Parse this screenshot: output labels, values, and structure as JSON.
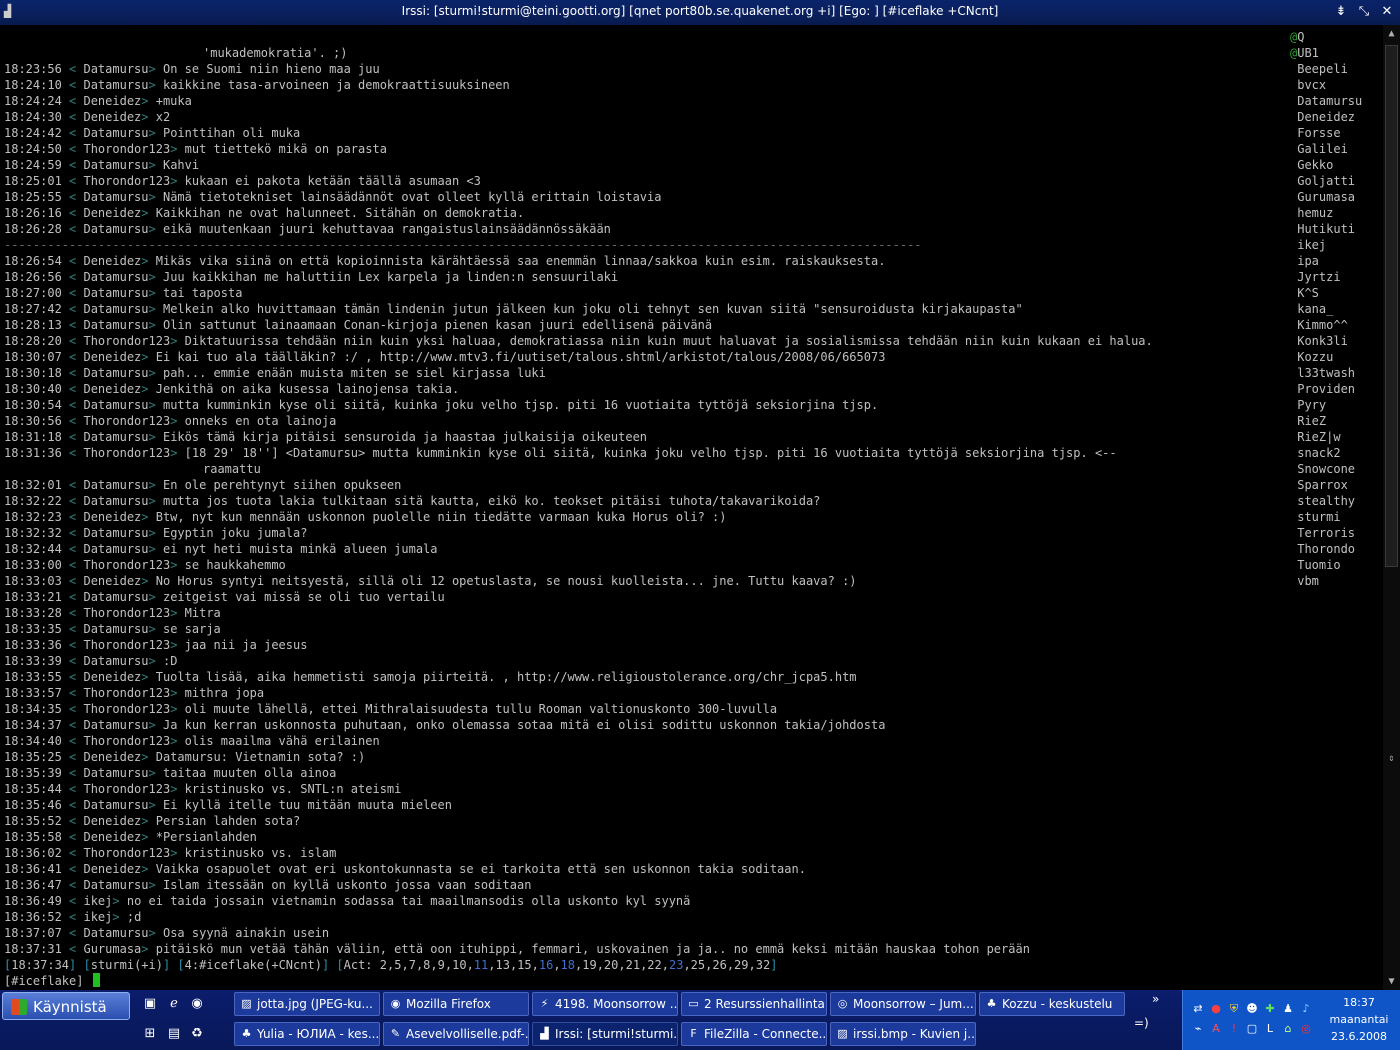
{
  "window": {
    "title": "Irssi: [sturmi!sturmi@teini.gootti.org] [qnet port80b.se.quakenet.org +i]  [Ego: ]  [#iceflake +CNcnt]",
    "app_icon": "terminal-icon",
    "buttons": [
      "minimize",
      "maximize",
      "close"
    ]
  },
  "chat": {
    "lines": [
      {
        "ts": "",
        "nick": "",
        "msg": "'mukademokratia'. ;)",
        "type": "cont"
      },
      {
        "ts": "18:23:56",
        "nick": "Datamursu",
        "msg": "On se Suomi niin hieno maa juu"
      },
      {
        "ts": "18:24:10",
        "nick": "Datamursu",
        "msg": "kaikkine tasa-arvoineen ja demokraattisuuksineen"
      },
      {
        "ts": "18:24:24",
        "nick": "Deneidez",
        "msg": "+muka"
      },
      {
        "ts": "18:24:30",
        "nick": "Deneidez",
        "msg": "x2"
      },
      {
        "ts": "18:24:42",
        "nick": "Datamursu",
        "msg": "Pointtihan oli muka"
      },
      {
        "ts": "18:24:50",
        "nick": "Thorondor123",
        "msg": "mut tiettekö mikä on parasta"
      },
      {
        "ts": "18:24:59",
        "nick": "Datamursu",
        "msg": "Kahvi"
      },
      {
        "ts": "18:25:01",
        "nick": "Thorondor123",
        "msg": "kukaan ei pakota ketään täällä asumaan <3"
      },
      {
        "ts": "18:25:55",
        "nick": "Datamursu",
        "msg": "Nämä tietotekniset lainsäädännöt ovat olleet kyllä erittain loistavia"
      },
      {
        "ts": "18:26:16",
        "nick": "Deneidez",
        "msg": "Kaikkihan ne ovat halunneet. Sitähän on demokratia."
      },
      {
        "ts": "18:26:28",
        "nick": "Datamursu",
        "msg": "eikä muutenkaan juuri kehuttavaa rangaistuslainsäädännössäkään"
      },
      {
        "ts": "",
        "nick": "",
        "msg": "-------------------------------------------------------------------------------------------------------------------------------",
        "type": "marker"
      },
      {
        "ts": "18:26:54",
        "nick": "Deneidez",
        "msg": "Mikäs vika siinä on että kopioinnista kärähtäessä saa enemmän linnaa/sakkoa kuin esim. raiskauksesta."
      },
      {
        "ts": "18:26:56",
        "nick": "Datamursu",
        "msg": "Juu kaikkihan me haluttiin Lex karpela ja linden:n sensuurilaki"
      },
      {
        "ts": "18:27:00",
        "nick": "Datamursu",
        "msg": "tai taposta"
      },
      {
        "ts": "18:27:42",
        "nick": "Datamursu",
        "msg": "Melkein alko huvittamaan tämän lindenin jutun jälkeen kun joku oli tehnyt sen kuvan siitä \"sensuroidusta kirjakaupasta\""
      },
      {
        "ts": "18:28:13",
        "nick": "Datamursu",
        "msg": "Olin sattunut lainaamaan Conan-kirjoja pienen kasan juuri edellisenä päivänä"
      },
      {
        "ts": "18:28:20",
        "nick": "Thorondor123",
        "msg": "Diktatuurissa tehdään niin kuin yksi haluaa, demokratiassa niin kuin muut haluavat ja sosialismissa tehdään niin kuin kukaan ei halua."
      },
      {
        "ts": "18:30:07",
        "nick": "Deneidez",
        "msg": "Ei kai tuo ala täälläkin? :/ , http://www.mtv3.fi/uutiset/talous.shtml/arkistot/talous/2008/06/665073"
      },
      {
        "ts": "18:30:18",
        "nick": "Datamursu",
        "msg": "pah... emmie enään muista miten se siel kirjassa luki"
      },
      {
        "ts": "18:30:40",
        "nick": "Deneidez",
        "msg": "Jenkithä on aika kusessa lainojensa takia."
      },
      {
        "ts": "18:30:54",
        "nick": "Datamursu",
        "msg": "mutta kumminkin kyse oli siitä, kuinka joku velho tjsp. piti 16 vuotiaita tyttöjä seksiorjina tjsp."
      },
      {
        "ts": "18:30:56",
        "nick": "Thorondor123",
        "msg": "onneks en ota lainoja"
      },
      {
        "ts": "18:31:18",
        "nick": "Datamursu",
        "msg": "Eikös tämä kirja pitäisi sensuroida ja haastaa julkaisija oikeuteen"
      },
      {
        "ts": "18:31:36",
        "nick": "Thorondor123",
        "msg": "[18 29' 18''] <Datamursu> mutta kumminkin kyse oli siitä, kuinka joku velho tjsp. piti 16 vuotiaita tyttöjä seksiorjina tjsp. <--"
      },
      {
        "ts": "",
        "nick": "",
        "msg": "raamattu",
        "type": "cont"
      },
      {
        "ts": "18:32:01",
        "nick": "Datamursu",
        "msg": "En ole perehtynyt siihen opukseen"
      },
      {
        "ts": "18:32:22",
        "nick": "Datamursu",
        "msg": "mutta jos tuota lakia tulkitaan sitä kautta, eikö ko. teokset pitäisi tuhota/takavarikoida?"
      },
      {
        "ts": "18:32:23",
        "nick": "Deneidez",
        "msg": "Btw, nyt kun mennään uskonnon puolelle niin tiedätte varmaan kuka Horus oli? :)"
      },
      {
        "ts": "18:32:32",
        "nick": "Datamursu",
        "msg": "Egyptin joku jumala?"
      },
      {
        "ts": "18:32:44",
        "nick": "Datamursu",
        "msg": "ei nyt heti muista minkä alueen jumala"
      },
      {
        "ts": "18:33:00",
        "nick": "Thorondor123",
        "msg": "se haukkahemmo"
      },
      {
        "ts": "18:33:03",
        "nick": "Deneidez",
        "msg": "No Horus syntyi neitsyestä, sillä oli 12 opetuslasta, se nousi kuolleista... jne. Tuttu kaava? :)"
      },
      {
        "ts": "18:33:21",
        "nick": "Datamursu",
        "msg": "zeitgeist vai missä se oli tuo vertailu"
      },
      {
        "ts": "18:33:28",
        "nick": "Thorondor123",
        "msg": "Mitra"
      },
      {
        "ts": "18:33:35",
        "nick": "Datamursu",
        "msg": "se sarja"
      },
      {
        "ts": "18:33:36",
        "nick": "Thorondor123",
        "msg": "jaa nii ja jeesus"
      },
      {
        "ts": "18:33:39",
        "nick": "Datamursu",
        "msg": ":D"
      },
      {
        "ts": "18:33:55",
        "nick": "Deneidez",
        "msg": "Tuolta lisää, aika hemmetisti samoja piirteitä. , http://www.religioustolerance.org/chr_jcpa5.htm"
      },
      {
        "ts": "18:33:57",
        "nick": "Thorondor123",
        "msg": "mithra jopa"
      },
      {
        "ts": "18:34:35",
        "nick": "Thorondor123",
        "msg": "oli muute lähellä, ettei Mithralaisuudesta tullu Rooman valtionuskonto 300-luvulla"
      },
      {
        "ts": "18:34:37",
        "nick": "Datamursu",
        "msg": "Ja kun kerran uskonnosta puhutaan, onko olemassa sotaa mitä ei olisi sodittu uskonnon takia/johdosta"
      },
      {
        "ts": "18:34:40",
        "nick": "Thorondor123",
        "msg": "olis maailma vähä erilainen"
      },
      {
        "ts": "18:35:25",
        "nick": "Deneidez",
        "msg": "Datamursu: Vietnamin sota? :)"
      },
      {
        "ts": "18:35:39",
        "nick": "Datamursu",
        "msg": "taitaa muuten olla ainoa"
      },
      {
        "ts": "18:35:44",
        "nick": "Thorondor123",
        "msg": "kristinusko vs. SNTL:n ateismi"
      },
      {
        "ts": "18:35:46",
        "nick": "Datamursu",
        "msg": "Ei kyllä itelle tuu mitään muuta mieleen"
      },
      {
        "ts": "18:35:52",
        "nick": "Deneidez",
        "msg": "Persian lahden sota?"
      },
      {
        "ts": "18:35:58",
        "nick": "Deneidez",
        "msg": "*Persianlahden"
      },
      {
        "ts": "18:36:02",
        "nick": "Thorondor123",
        "msg": "kristinusko vs. islam"
      },
      {
        "ts": "18:36:41",
        "nick": "Deneidez",
        "msg": "Vaikka osapuolet ovat eri uskontokunnasta se ei tarkoita että sen uskonnon takia soditaan."
      },
      {
        "ts": "18:36:47",
        "nick": "Datamursu",
        "msg": "Islam itessään on kyllä uskonto jossa vaan soditaan"
      },
      {
        "ts": "18:36:49",
        "nick": "ikej",
        "msg": "no ei taida jossain vietnamin sodassa tai maailmansodis olla uskonto kyl syynä"
      },
      {
        "ts": "18:36:52",
        "nick": "ikej",
        "msg": ";d"
      },
      {
        "ts": "18:37:07",
        "nick": "Datamursu",
        "msg": "Osa syynä ainakin usein"
      },
      {
        "ts": "18:37:31",
        "nick": "Gurumasa",
        "msg": "pitäiskö mun vetää tähän väliin, että oon ituhippi, femmari, uskovainen ja ja.. no emmä keksi mitään hauskaa tohon perään"
      }
    ]
  },
  "nicklist": [
    {
      "mode": "@",
      "name": "Q"
    },
    {
      "mode": "@",
      "name": "UB1"
    },
    {
      "mode": " ",
      "name": "Beepeli"
    },
    {
      "mode": " ",
      "name": "bvcx"
    },
    {
      "mode": " ",
      "name": "Datamursu"
    },
    {
      "mode": " ",
      "name": "Deneidez"
    },
    {
      "mode": " ",
      "name": "Forsse"
    },
    {
      "mode": " ",
      "name": "Galilei"
    },
    {
      "mode": " ",
      "name": "Gekko"
    },
    {
      "mode": " ",
      "name": "Goljatti"
    },
    {
      "mode": " ",
      "name": "Gurumasa"
    },
    {
      "mode": " ",
      "name": "hemuz"
    },
    {
      "mode": " ",
      "name": "Hutikuti"
    },
    {
      "mode": " ",
      "name": "ikej"
    },
    {
      "mode": " ",
      "name": "ipa"
    },
    {
      "mode": " ",
      "name": "Jyrtzi"
    },
    {
      "mode": " ",
      "name": "K^S"
    },
    {
      "mode": " ",
      "name": "kana_"
    },
    {
      "mode": " ",
      "name": "Kimmo^^"
    },
    {
      "mode": " ",
      "name": "Konk3li"
    },
    {
      "mode": " ",
      "name": "Kozzu"
    },
    {
      "mode": " ",
      "name": "l33twash"
    },
    {
      "mode": " ",
      "name": "Providen"
    },
    {
      "mode": " ",
      "name": "Pyry"
    },
    {
      "mode": " ",
      "name": "RieZ"
    },
    {
      "mode": " ",
      "name": "RieZ|w"
    },
    {
      "mode": " ",
      "name": "snack2"
    },
    {
      "mode": " ",
      "name": "Snowcone"
    },
    {
      "mode": " ",
      "name": "Sparrox"
    },
    {
      "mode": " ",
      "name": "stealthy"
    },
    {
      "mode": " ",
      "name": "sturmi"
    },
    {
      "mode": " ",
      "name": "Terroris"
    },
    {
      "mode": " ",
      "name": "Thorondo"
    },
    {
      "mode": " ",
      "name": "Tuomio"
    },
    {
      "mode": " ",
      "name": "vbm"
    }
  ],
  "statusbar": {
    "time": "18:37:34",
    "nick": "sturmi(+i)",
    "window": "4:#iceflake(+CNcnt)",
    "act_label": "Act:",
    "act_items": [
      {
        "n": "2",
        "hl": false
      },
      {
        "n": "5",
        "hl": false
      },
      {
        "n": "7",
        "hl": false
      },
      {
        "n": "8",
        "hl": false
      },
      {
        "n": "9",
        "hl": false
      },
      {
        "n": "10",
        "hl": false
      },
      {
        "n": "11",
        "hl": true
      },
      {
        "n": "13",
        "hl": false
      },
      {
        "n": "15",
        "hl": false
      },
      {
        "n": "16",
        "hl": true
      },
      {
        "n": "18",
        "hl": true
      },
      {
        "n": "19",
        "hl": false
      },
      {
        "n": "20",
        "hl": false
      },
      {
        "n": "21",
        "hl": false
      },
      {
        "n": "22",
        "hl": false
      },
      {
        "n": "23",
        "hl": true
      },
      {
        "n": "25",
        "hl": false
      },
      {
        "n": "26",
        "hl": false
      },
      {
        "n": "29",
        "hl": false
      },
      {
        "n": "32",
        "hl": false
      }
    ]
  },
  "input": {
    "prompt": "[#iceflake]"
  },
  "colors": {
    "cursor": "#21c021",
    "bracket": "#2f7f7f",
    "op": "#2fa02f",
    "status": "#2f8fa8",
    "act_hl": "#3f6fd0"
  },
  "taskbar": {
    "start_label": "Käynnistä",
    "quicklaunch": [
      "desktop-icon",
      "ie-icon",
      "firefox-icon",
      "network-icon",
      "cmd-icon",
      "recycle-icon"
    ],
    "row1": [
      {
        "label": "jotta.jpg (JPEG-ku...",
        "icon": "image-icon"
      },
      {
        "label": "Mozilla Firefox",
        "icon": "firefox-icon"
      },
      {
        "label": "4198. Moonsorrow ...",
        "icon": "winamp-icon"
      },
      {
        "label": "2 Resurssienhallinta",
        "icon": "folder-icon"
      },
      {
        "label": "Moonsorrow – Jum...",
        "icon": "opera-icon"
      },
      {
        "label": "Kozzu - keskustelu",
        "icon": "msn-icon"
      }
    ],
    "row2": [
      {
        "label": "Yulia - ЮЛИА - kes...",
        "icon": "msn-icon"
      },
      {
        "label": "Asevelvolliselle.pdf-...",
        "icon": "pdf-icon"
      },
      {
        "label": "Irssi: [sturmi!sturmi...",
        "icon": "terminal-icon"
      },
      {
        "label": "FileZilla - Connecte...",
        "icon": "filezilla-icon"
      },
      {
        "label": "irssi.bmp - Kuvien j...",
        "icon": "image-icon"
      }
    ],
    "more": "»",
    "smiley": "=)",
    "clock_time": "18:37",
    "clock_day": "maanantai",
    "clock_date": "23.6.2008"
  }
}
